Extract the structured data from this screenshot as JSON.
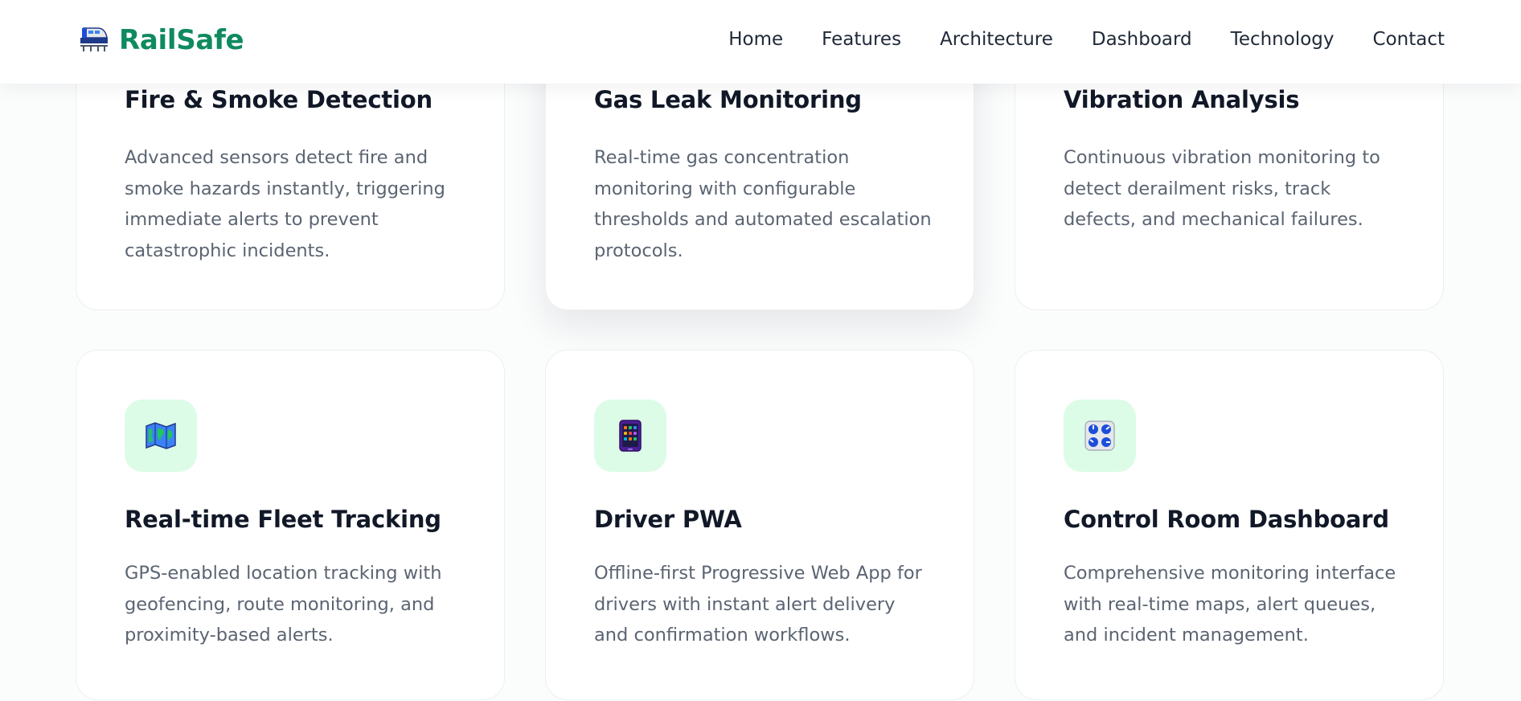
{
  "brand": {
    "name": "RailSafe",
    "logo_icon": "train-icon",
    "color": "#0f8a5f"
  },
  "nav": {
    "links": [
      "Home",
      "Features",
      "Architecture",
      "Dashboard",
      "Technology",
      "Contact"
    ]
  },
  "features": [
    {
      "title": "Fire & Smoke Detection",
      "description": "Advanced sensors detect fire and smoke hazards instantly, triggering immediate alerts to prevent catastrophic incidents."
    },
    {
      "title": "Gas Leak Monitoring",
      "description": "Real-time gas concentration monitoring with configurable thresholds and automated escalation protocols."
    },
    {
      "title": "Vibration Analysis",
      "description": "Continuous vibration monitoring to detect derailment risks, track defects, and mechanical failures."
    },
    {
      "title": "Real-time Fleet Tracking",
      "description": "GPS-enabled location tracking with geofencing, route monitoring, and proximity-based alerts.",
      "icon": "map-icon"
    },
    {
      "title": "Driver PWA",
      "description": "Offline-first Progressive Web App for drivers with instant alert delivery and confirmation workflows.",
      "icon": "mobile-app-icon"
    },
    {
      "title": "Control Room Dashboard",
      "description": "Comprehensive monitoring interface with real-time maps, alert queues, and incident management.",
      "icon": "control-knobs-icon"
    }
  ],
  "colors": {
    "icon_background": "#dcfce7",
    "heading": "#111827",
    "body_text": "#5b6472"
  }
}
